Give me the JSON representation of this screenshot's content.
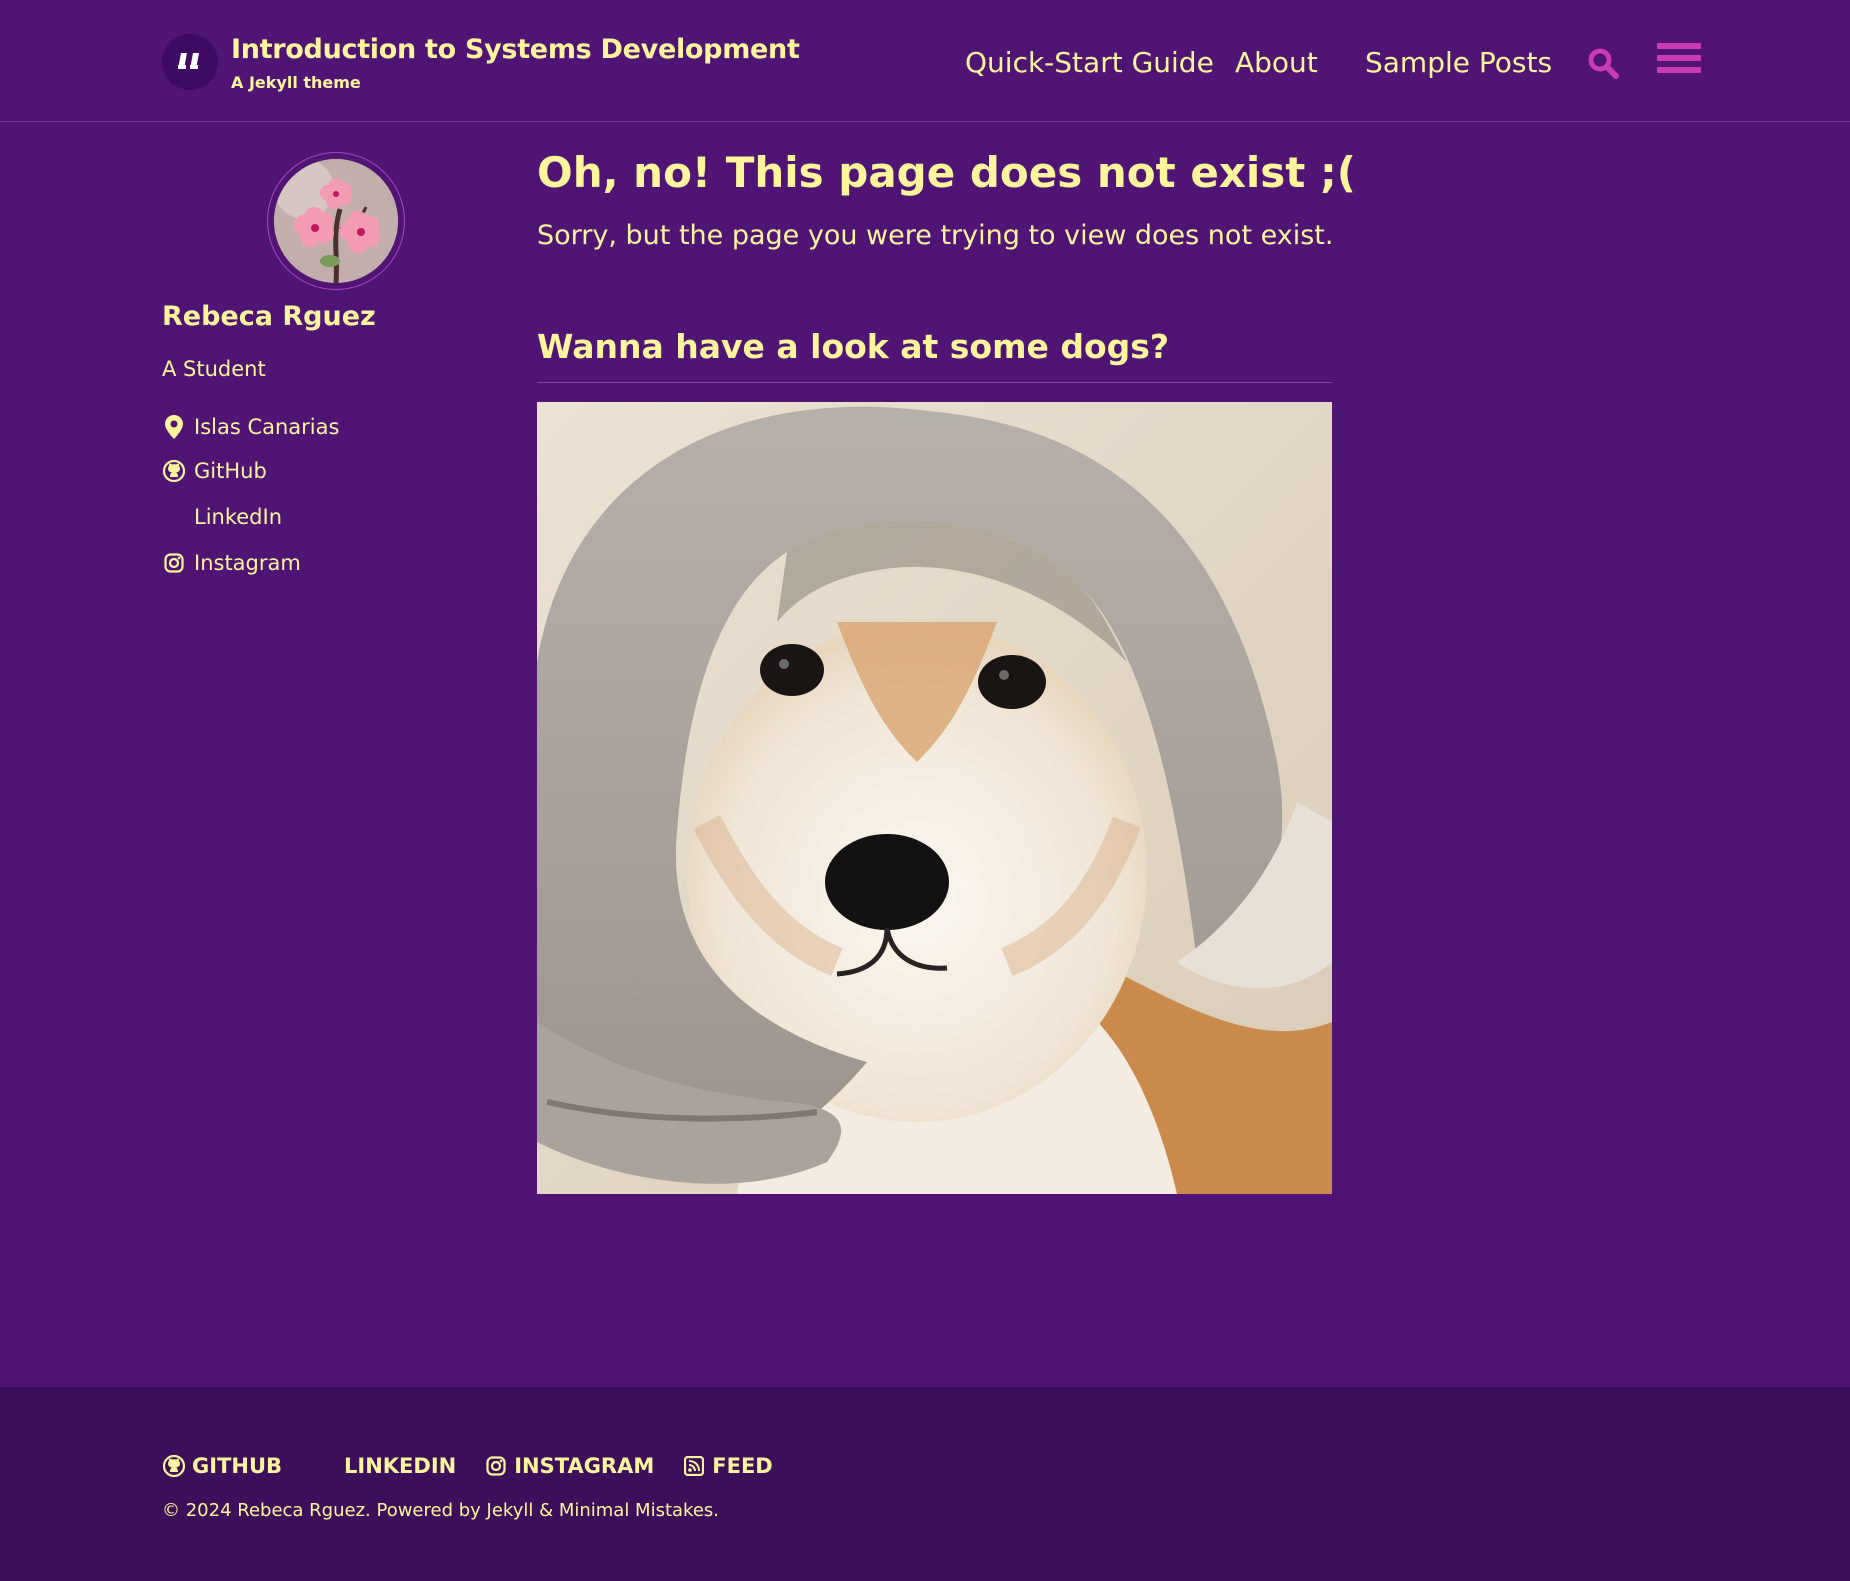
{
  "colors": {
    "background": "#501474",
    "text": "#fff59d",
    "accent": "#c93ab3",
    "footer_background": "#3d0f5a"
  },
  "masthead": {
    "logo_icon": "quote-logo-icon",
    "title": "Introduction to Systems Development",
    "subtitle": "A Jekyll theme",
    "nav": [
      {
        "label": "Quick-Start Guide"
      },
      {
        "label": "About"
      },
      {
        "label": "Sample Posts"
      }
    ],
    "search_icon": "search-icon",
    "menu_icon": "hamburger-menu-icon"
  },
  "sidebar": {
    "author_name": "Rebeca Rguez",
    "author_bio": "A Student",
    "links": [
      {
        "label": "Islas Canarias",
        "icon": "map-marker-icon"
      },
      {
        "label": "GitHub",
        "icon": "github-icon"
      },
      {
        "label": "LinkedIn",
        "icon": ""
      },
      {
        "label": "Instagram",
        "icon": "instagram-icon"
      }
    ]
  },
  "main": {
    "title": "Oh, no! This page does not exist ;(",
    "lead": "Sorry, but the page you were trying to view does not exist.",
    "section_heading": "Wanna have a look at some dogs?"
  },
  "footer": {
    "follow": [
      {
        "label": "GITHUB",
        "icon": "github-icon"
      },
      {
        "label": "LINKEDIN",
        "icon": ""
      },
      {
        "label": "INSTAGRAM",
        "icon": "instagram-icon"
      },
      {
        "label": "FEED",
        "icon": "rss-feed-icon"
      }
    ],
    "copyright": "© 2024 Rebeca Rguez. Powered by Jekyll & Minimal Mistakes."
  }
}
